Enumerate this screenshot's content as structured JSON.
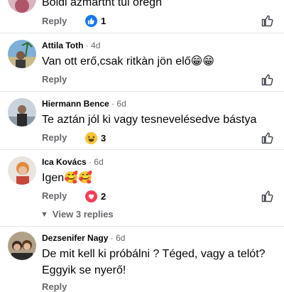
{
  "comments": [
    {
      "text": "Boldi azmártnt túl öregh",
      "reply_label": "Reply",
      "reaction_icon": "thumbs-up-icon",
      "reaction_count": "1"
    },
    {
      "author": "Attila Toth",
      "time": "4d",
      "text": "Van ott erő,csak ritkàn jön elő😁😁",
      "reply_label": "Reply"
    },
    {
      "author": "Hiermann Bence",
      "time": "6d",
      "text": "Te aztán jól ki vagy tesnevelésedve bástya",
      "reply_label": "Reply",
      "reaction_icon": "laughing-face-icon",
      "reaction_count": "3"
    },
    {
      "author": "Ica Kovács",
      "time": "6d",
      "text": "Igen🥰🥰",
      "reply_label": "Reply",
      "reaction_icon": "heart-icon",
      "reaction_count": "2",
      "replies_label": "View 3 replies"
    },
    {
      "author": "Dezsenifer Nagy",
      "time": "6d",
      "text_lines": [
        "De mit kell ki próbálni  ? Téged, vagy a telót?",
        "Eggyik se nyerő!"
      ],
      "reply_label": "Reply"
    }
  ],
  "separator": "·",
  "colors": {
    "like_blue": "#1877f2",
    "heart_red": "#f33e58",
    "haha_yellow": "#f7b125",
    "muted": "#65676b"
  }
}
